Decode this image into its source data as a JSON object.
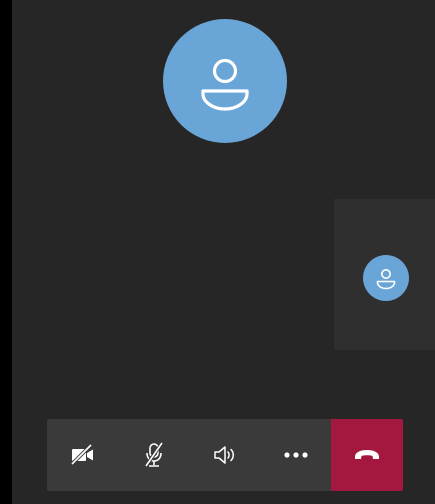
{
  "call": {
    "participant": {
      "avatar_icon": "person-icon",
      "avatar_color": "#6aa5d7"
    },
    "self_preview": {
      "avatar_icon": "person-icon",
      "avatar_color": "#6aa5d7"
    }
  },
  "controls": {
    "camera": {
      "icon": "camera-off-icon",
      "state": "off"
    },
    "microphone": {
      "icon": "mic-off-icon",
      "state": "muted"
    },
    "speaker": {
      "icon": "speaker-icon"
    },
    "more": {
      "icon": "more-icon"
    },
    "hangup": {
      "icon": "hangup-icon",
      "color": "#a4173f"
    }
  },
  "colors": {
    "background": "#262626",
    "control_bar": "#3a3a3a",
    "icon": "#ffffff"
  }
}
